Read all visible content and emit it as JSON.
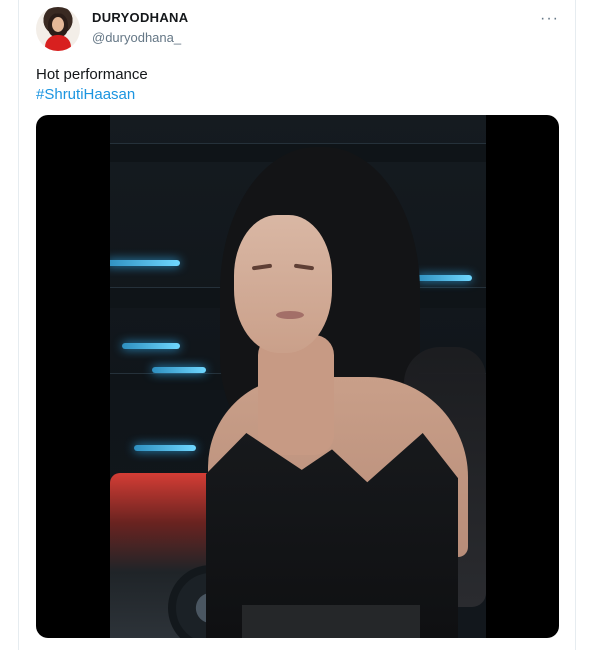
{
  "tweet": {
    "display_name": "DURYODHANA",
    "handle": "@duryodhana_",
    "text": "Hot performance",
    "hashtag": "#ShrutiHaasan",
    "more_label": "···"
  },
  "icons": {
    "more": "more-icon",
    "avatar": "avatar-image"
  }
}
